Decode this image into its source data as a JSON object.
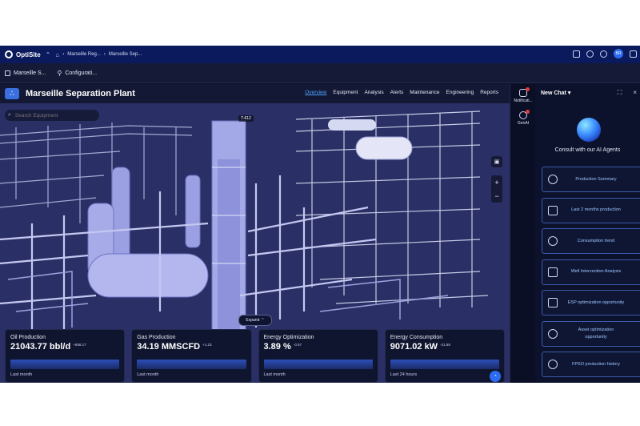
{
  "topbar": {
    "app_name": "OptiSite",
    "crumbs": [
      "Marseille Reg...",
      "Marseille Sep..."
    ],
    "avatar": "BR"
  },
  "subbar": {
    "items": [
      "Marseille S...",
      "Configurati..."
    ]
  },
  "plant": {
    "title": "Marseille Separation Plant",
    "tabs": [
      "Overview",
      "Equipment",
      "Analysis",
      "Alerts",
      "Maintenance",
      "Engineering",
      "Reports"
    ],
    "active_tab": "Overview",
    "search_placeholder": "Search Equipment",
    "equipment_tag": "T-612",
    "expand_label": "Expand"
  },
  "kpis": [
    {
      "title": "Oil Production",
      "value": "21043.77 bbl/d",
      "delta": "+858.17",
      "period": "Last month"
    },
    {
      "title": "Gas Production",
      "value": "34.19 MMSCFD",
      "delta": "+1.23",
      "period": "Last month"
    },
    {
      "title": "Energy Optimization",
      "value": "3.89 %",
      "delta": "-0.57",
      "period": "Last month"
    },
    {
      "title": "Energy Consumption",
      "value": "9071.02 kW",
      "delta": "-21.89",
      "period": "Last 24 hours"
    }
  ],
  "rail": {
    "notifications_label": "Notificati...",
    "genai_label": "GenAI"
  },
  "chat": {
    "title": "New Chat",
    "consult_text": "Consult with our AI Agents",
    "agents": [
      "Production Summary",
      "Last 2 months production",
      "Consumption trend",
      "Well Intervention Analysis",
      "ESP optimization opportunity",
      "Asset optimization opportunity",
      "FPSO production history"
    ]
  },
  "colors": {
    "topbar": "#0a1a5c",
    "accent": "#4da3ff",
    "agent_text": "#9cc6ff",
    "badge": "#e23b3b"
  }
}
